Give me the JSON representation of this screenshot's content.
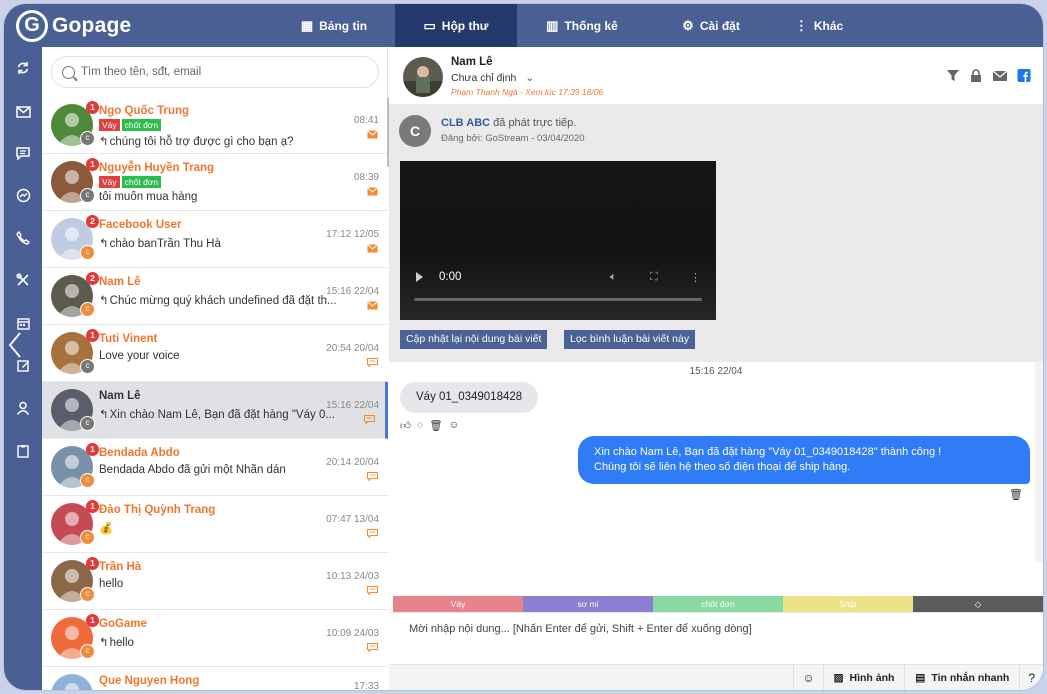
{
  "app": {
    "logo_letter": "G",
    "name": "Gopage"
  },
  "nav": [
    {
      "icon": "▦",
      "label": "Bảng tin",
      "active": false
    },
    {
      "icon": "▭",
      "label": "Hộp thư",
      "active": true
    },
    {
      "icon": "▥",
      "label": "Thống kê",
      "active": false
    },
    {
      "icon": "⚙",
      "label": "Cài đặt",
      "active": false
    },
    {
      "icon": "⋮",
      "label": "Khác",
      "active": false
    }
  ],
  "rail": [
    "refresh-icon",
    "mail-icon",
    "comment-icon",
    "messenger-icon",
    "phone-icon",
    "tools-icon",
    "calendar-icon",
    "edit-icon",
    "user-icon",
    "clipboard-icon"
  ],
  "search": {
    "placeholder": "Tìm theo tên, sđt, email"
  },
  "conversations": [
    {
      "name": "Ngo Quốc Trung",
      "count": "1",
      "tags": [
        "Váy",
        "chốt đơn"
      ],
      "reply": true,
      "message": "chúng tôi hỗ trợ được gì cho bạn ạ?",
      "time": "08:41",
      "type": "mail"
    },
    {
      "name": "Nguyễn Huyền Trang",
      "count": "1",
      "tags": [
        "Váy",
        "chốt đơn"
      ],
      "reply": false,
      "message": "tôi muốn mua hàng",
      "time": "08:39",
      "type": "mail"
    },
    {
      "name": "Facebook User",
      "count": "2",
      "tags": [],
      "reply": true,
      "message": "chào banTrần Thu Hà",
      "time": "17:12 12/05",
      "type": "mail"
    },
    {
      "name": "Nam Lê",
      "count": "2",
      "tags": [],
      "reply": true,
      "message": "Chúc mừng quý khách undefined đã đặt th...",
      "time": "15:16 22/04",
      "type": "mail"
    },
    {
      "name": "Tuti Vinent",
      "count": "1",
      "tags": [],
      "reply": false,
      "message": "Love your voice",
      "time": "20:54 20/04",
      "type": "comment"
    },
    {
      "name": "Nam Lê",
      "count": "",
      "tags": [],
      "reply": true,
      "message": "Xin chào Nam Lê, Bạn đã đặt hàng \"Váy 0...",
      "time": "15:16 22/04",
      "type": "comment",
      "selected": true
    },
    {
      "name": "Bendada Abdo",
      "count": "1",
      "tags": [],
      "reply": false,
      "message": "Bendada Abdo đã gửi một Nhãn dán",
      "time": "20:14 20/04",
      "type": "comment"
    },
    {
      "name": "Đào Thị Quỳnh Trang",
      "count": "1",
      "tags": [],
      "reply": false,
      "message": "💰",
      "time": "07:47 13/04",
      "type": "comment"
    },
    {
      "name": "Trần Hà",
      "count": "1",
      "tags": [],
      "reply": false,
      "message": "hello",
      "time": "10:13 24/03",
      "type": "comment"
    },
    {
      "name": "GoGame",
      "count": "1",
      "tags": [],
      "reply": true,
      "message": "hello",
      "time": "10:09 24/03",
      "type": "comment"
    },
    {
      "name": "Que Nguyen Hong",
      "count": "",
      "tags": [],
      "reply": false,
      "message": "",
      "time": "17:33",
      "type": "comment"
    }
  ],
  "chat": {
    "name": "Nam Lê",
    "assign": "Chưa chỉ định",
    "seen": "Phạm Thanh Ngà - Xem lúc 17:39 18/06",
    "post": {
      "avatar_letter": "C",
      "page": "CLB ABC",
      "action": " đã phát trực tiếp.",
      "posted_by": "Đăng bởi: GoStream - 03/04/2020",
      "video_time": "0:00",
      "btn_update": "Cập nhật lại nội dung bài viết",
      "btn_filter": "Lọc bình luận bài viết này"
    },
    "time_divider": "15:16 22/04",
    "incoming": "Váy 01_0349018428",
    "outgoing_line1": "Xin chào Nam Lê, Bạn đã đặt hàng \"Váy 01_0349018428\" thành công !",
    "outgoing_line2": "Chúng tôi sẽ liên hệ theo số điện thoại để ship hàng.",
    "quick_tags": [
      {
        "label": "Váy",
        "color": "#e7838d"
      },
      {
        "label": "sơ mi",
        "color": "#8a7fd0"
      },
      {
        "label": "chốt đơn",
        "color": "#8ad9a2"
      },
      {
        "label": "Ship",
        "color": "#ece28a"
      },
      {
        "label": "",
        "color": "#5c5c5c"
      }
    ],
    "composer_placeholder": "Mời nhập nội dung... [Nhấn Enter để gửi, Shift + Enter để xuống dòng]",
    "btn_image": "Hình ảnh",
    "btn_quick": "Tin nhắn nhanh"
  },
  "colors": {
    "topbar": "#4a5f93",
    "active_nav": "#243a6d",
    "accent_orange": "#f0762e",
    "outgoing_bubble": "#2f7cf6"
  }
}
